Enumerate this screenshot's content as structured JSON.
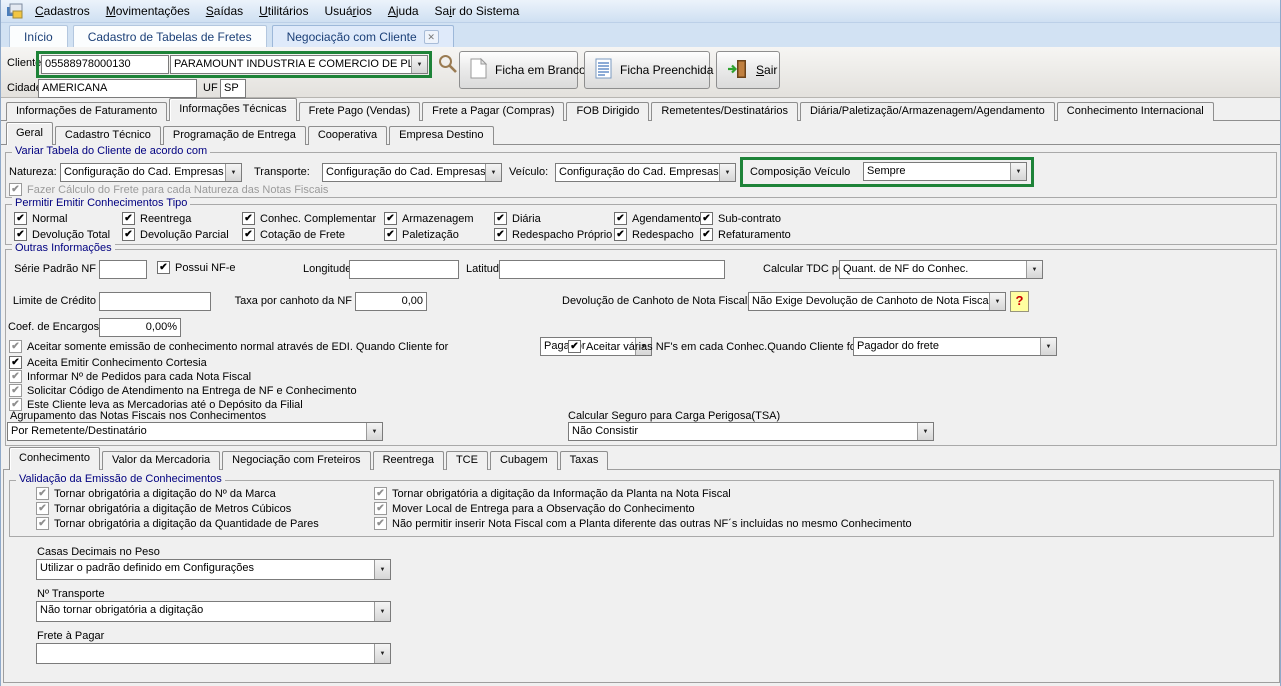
{
  "colors": {
    "highlight_green": "#1e8338",
    "legend_blue": "#000080"
  },
  "menu": {
    "items": [
      {
        "pre": "",
        "accel": "C",
        "post": "adastros"
      },
      {
        "pre": "",
        "accel": "M",
        "post": "ovimentações"
      },
      {
        "pre": "",
        "accel": "S",
        "post": "aídas"
      },
      {
        "pre": "",
        "accel": "U",
        "post": "tilitários"
      },
      {
        "pre": "Usuá",
        "accel": "r",
        "post": "ios"
      },
      {
        "pre": "",
        "accel": "A",
        "post": "juda"
      },
      {
        "pre": "Sa",
        "accel": "i",
        "post": "r do Sistema"
      }
    ]
  },
  "doc_tabs": {
    "inicio": "Início",
    "cadastro_tabelas": "Cadastro de Tabelas de Fretes",
    "negociacao": "Negociação com Cliente"
  },
  "client": {
    "cliente_label": "Cliente",
    "codigo": "05588978000130",
    "nome": "PARAMOUNT INDUSTRIA E COMERCIO DE PLAST",
    "cidade_label": "Cidade",
    "cidade": "AMERICANA",
    "uf_label": "UF",
    "uf": "SP",
    "ficha_branco": "Ficha em Branco",
    "ficha_preenchida": "Ficha Preenchida",
    "sair_accel": "S",
    "sair_rest": "air"
  },
  "main_tabs": [
    "Informações de Faturamento",
    "Informações Técnicas",
    "Frete Pago (Vendas)",
    "Frete a Pagar (Compras)",
    "FOB Dirigido",
    "Remetentes/Destinatários",
    "Diária/Paletização/Armazenagem/Agendamento",
    "Conhecimento Internacional"
  ],
  "sub_tabs": [
    "Geral",
    "Cadastro Técnico",
    "Programação de Entrega",
    "Cooperativa",
    "Empresa Destino"
  ],
  "variar": {
    "legend": "Variar Tabela do Cliente de acordo com",
    "natureza_label": "Natureza:",
    "natureza_value": "Configuração do Cad. Empresas",
    "transporte_label": "Transporte:",
    "transporte_value": "Configuração do Cad. Empresas",
    "veiculo_label": "Veículo:",
    "veiculo_value": "Configuração do Cad. Empresas",
    "composicao_label": "Composição Veículo",
    "composicao_value": "Sempre",
    "calc_natureza_label": "Fazer Cálculo do Frete para cada Natureza das Notas Fiscais"
  },
  "tipos": {
    "legend": "Permitir Emitir Conhecimentos Tipo",
    "row1": [
      "Normal",
      "Reentrega",
      "Conhec. Complementar",
      "Armazenagem",
      "Diária",
      "Agendamento",
      "Sub-contrato"
    ],
    "row2": [
      "Devolução Total",
      "Devolução Parcial",
      "Cotação de Frete",
      "Paletização",
      "Redespacho Próprio",
      "Redespacho",
      "Refaturamento"
    ]
  },
  "outras": {
    "legend": "Outras Informações",
    "serie_label": "Série Padrão NF",
    "serie_value": "",
    "possui_nfe_label": "Possui NF-e",
    "longitude_label": "Longitude",
    "longitude_value": "",
    "latitude_label": "Latitude",
    "latitude_value": "",
    "tdc_label": "Calcular TDC por",
    "tdc_value": "Quant. de NF do Conhec.",
    "limite_label": "Limite de Crédito",
    "limite_value": "",
    "taxa_label": "Taxa por canhoto da NF",
    "taxa_value": "0,00",
    "canhoto_label": "Devolução de Canhoto de Nota Fiscal",
    "canhoto_value": "Não Exige Devolução de Canhoto de Nota Fiscal",
    "help_label": "?",
    "coef_label": "Coef. de Encargos",
    "coef_value": "0,00%",
    "edi_label": "Aceitar somente emissão de conhecimento normal através de EDI. Quando Cliente for",
    "edi_value": "Pagador",
    "varias_label": "Aceitar várias NF's em cada Conhec.Quando Cliente for",
    "varias_value": "Pagador do frete",
    "cortesia_label": "Aceita Emitir Conhecimento Cortesia",
    "pedidos_label": "Informar Nº de Pedidos para cada Nota Fiscal",
    "atendimento_label": "Solicitar Código de Atendimento na Entrega de NF e Conhecimento",
    "deposito_label": "Este Cliente leva as Mercadorias até o Depósito da Filial",
    "agrupamento_label": "Agrupamento das Notas Fiscais nos Conhecimentos",
    "agrupamento_value": "Por Remetente/Destinatário",
    "seguro_label": "Calcular Seguro para Carga Perigosa(TSA)",
    "seguro_value": "Não Consistir"
  },
  "bottom_tabs": [
    "Conhecimento",
    "Valor da Mercadoria",
    "Negociação com Freteiros",
    "Reentrega",
    "TCE",
    "Cubagem",
    "Taxas"
  ],
  "validacao": {
    "legend": "Validação da Emissão de Conhecimentos",
    "left": [
      "Tornar obrigatória a digitação do Nº da Marca",
      "Tornar obrigatória a digitação de Metros Cúbicos",
      "Tornar obrigatória a digitação da Quantidade de Pares"
    ],
    "right": [
      "Tornar obrigatória a digitação da Informação da Planta na Nota Fiscal",
      "Mover Local de Entrega para a Observação do Conhecimento",
      "Não permitir inserir Nota Fiscal com a Planta diferente das outras NF´s  incluidas no mesmo Conhecimento"
    ]
  },
  "footer": {
    "casas_label": "Casas Decimais no Peso",
    "casas_value": "Utilizar o padrão definido em Configurações",
    "ntransporte_label": "Nº Transporte",
    "ntransporte_value": "Não tornar obrigatória a digitação",
    "frete_label": "Frete à Pagar",
    "frete_value": ""
  }
}
